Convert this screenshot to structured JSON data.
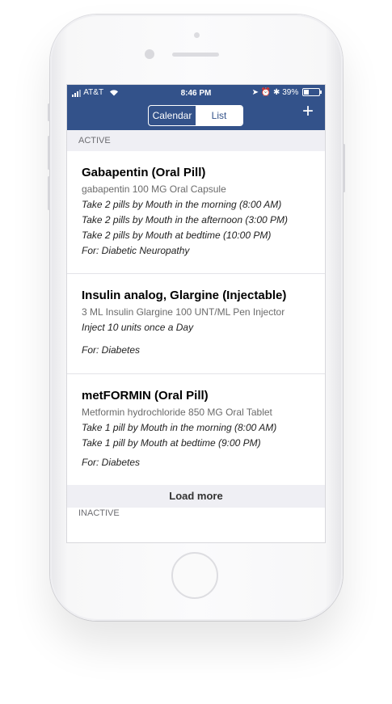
{
  "status_bar": {
    "carrier": "AT&T",
    "time": "8:46 PM",
    "battery": "39%"
  },
  "nav": {
    "segments": [
      "Calendar",
      "List"
    ],
    "selected": "List",
    "add_label": "+"
  },
  "sections": {
    "active_label": "ACTIVE",
    "inactive_label": "INACTIVE"
  },
  "medications": [
    {
      "name": "Gabapentin (Oral Pill)",
      "detail": "gabapentin 100 MG Oral Capsule",
      "instructions": [
        "Take 2 pills by Mouth in the morning (8:00 AM)",
        "Take 2 pills by Mouth in the afternoon (3:00 PM)",
        "Take 2 pills by Mouth at bedtime (10:00 PM)"
      ],
      "for": "For: Diabetic Neuropathy"
    },
    {
      "name": "Insulin analog, Glargine (Injectable)",
      "detail": "3 ML Insulin Glargine 100 UNT/ML Pen Injector",
      "instructions": [
        "Inject 10 units once a Day"
      ],
      "for": "For: Diabetes"
    },
    {
      "name": "metFORMIN (Oral Pill)",
      "detail": "Metformin hydrochloride 850 MG Oral Tablet",
      "instructions": [
        "Take 1 pill by Mouth in the morning (8:00 AM)",
        "Take 1 pill by Mouth at bedtime (9:00 PM)"
      ],
      "for": "For: Diabetes"
    }
  ],
  "load_more": "Load more",
  "colors": {
    "header": "#33528a",
    "section_bg": "#efeff4"
  }
}
